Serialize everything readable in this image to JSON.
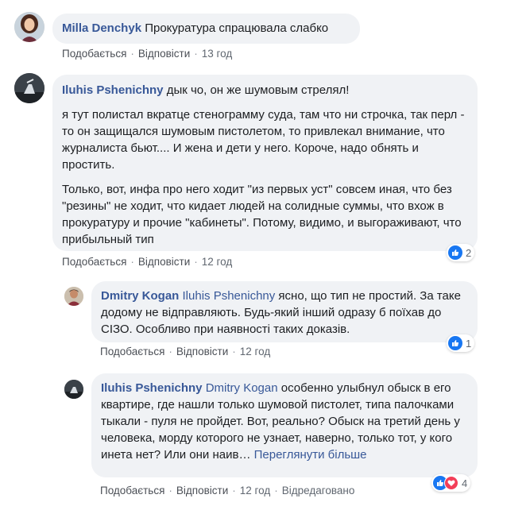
{
  "comments": [
    {
      "author": "Milla Denchyk",
      "text": "Прокуратура спрацювала слабко",
      "like_label": "Подобається",
      "reply_label": "Відповісти",
      "time": "13 год"
    },
    {
      "author": "Iluhis Pshenichny",
      "first_line": "дык чо, он же шумовым стрелял!",
      "paragraph2": "я тут полистал вкратце стенограмму суда, там что ни строчка, так перл - то он защищался шумовым пистолетом, то привлекал внимание, что журналиста бьют.... И жена и дети у него. Короче, надо обнять и простить.",
      "paragraph3": "Только, вот, инфа про него ходит \"из первых уст\" совсем иная, что без \"резины\" не ходит, что кидает людей на солидные суммы, что вхож в прокуратуру и прочие \"кабинеты\". Потому, видимо, и выгораживают, что прибыльный тип",
      "like_label": "Подобається",
      "reply_label": "Відповісти",
      "time": "12 год",
      "reaction_count": "2"
    },
    {
      "author": "Dmitry Kogan",
      "mention": "Iluhis Pshenichny",
      "text": "ясно, що тип не простий. За таке додому не відправляють. Будь-який інший одразу б поїхав до СІЗО. Особливо при наявності таких доказів.",
      "like_label": "Подобається",
      "reply_label": "Відповісти",
      "time": "12 год",
      "reaction_count": "1"
    },
    {
      "author": "Iluhis Pshenichny",
      "mention": "Dmitry Kogan",
      "text": "особенно улыбнул обыск в его квартире, где нашли только шумовой пистолет, типа палочками тыкали - пуля не пройдет. Вот, реально? Обыск на третий день у человека, морду которого не узнает, наверно, только тот, у кого инета нет? Или они наив…",
      "see_more": "Переглянути більше",
      "like_label": "Подобається",
      "reply_label": "Відповісти",
      "time": "12 год",
      "edited_label": "Відредаговано",
      "reaction_count": "4"
    }
  ],
  "colors": {
    "link": "#385898",
    "bubble": "#f0f2f5",
    "like": "#1877f2",
    "love": "#f33e58"
  }
}
